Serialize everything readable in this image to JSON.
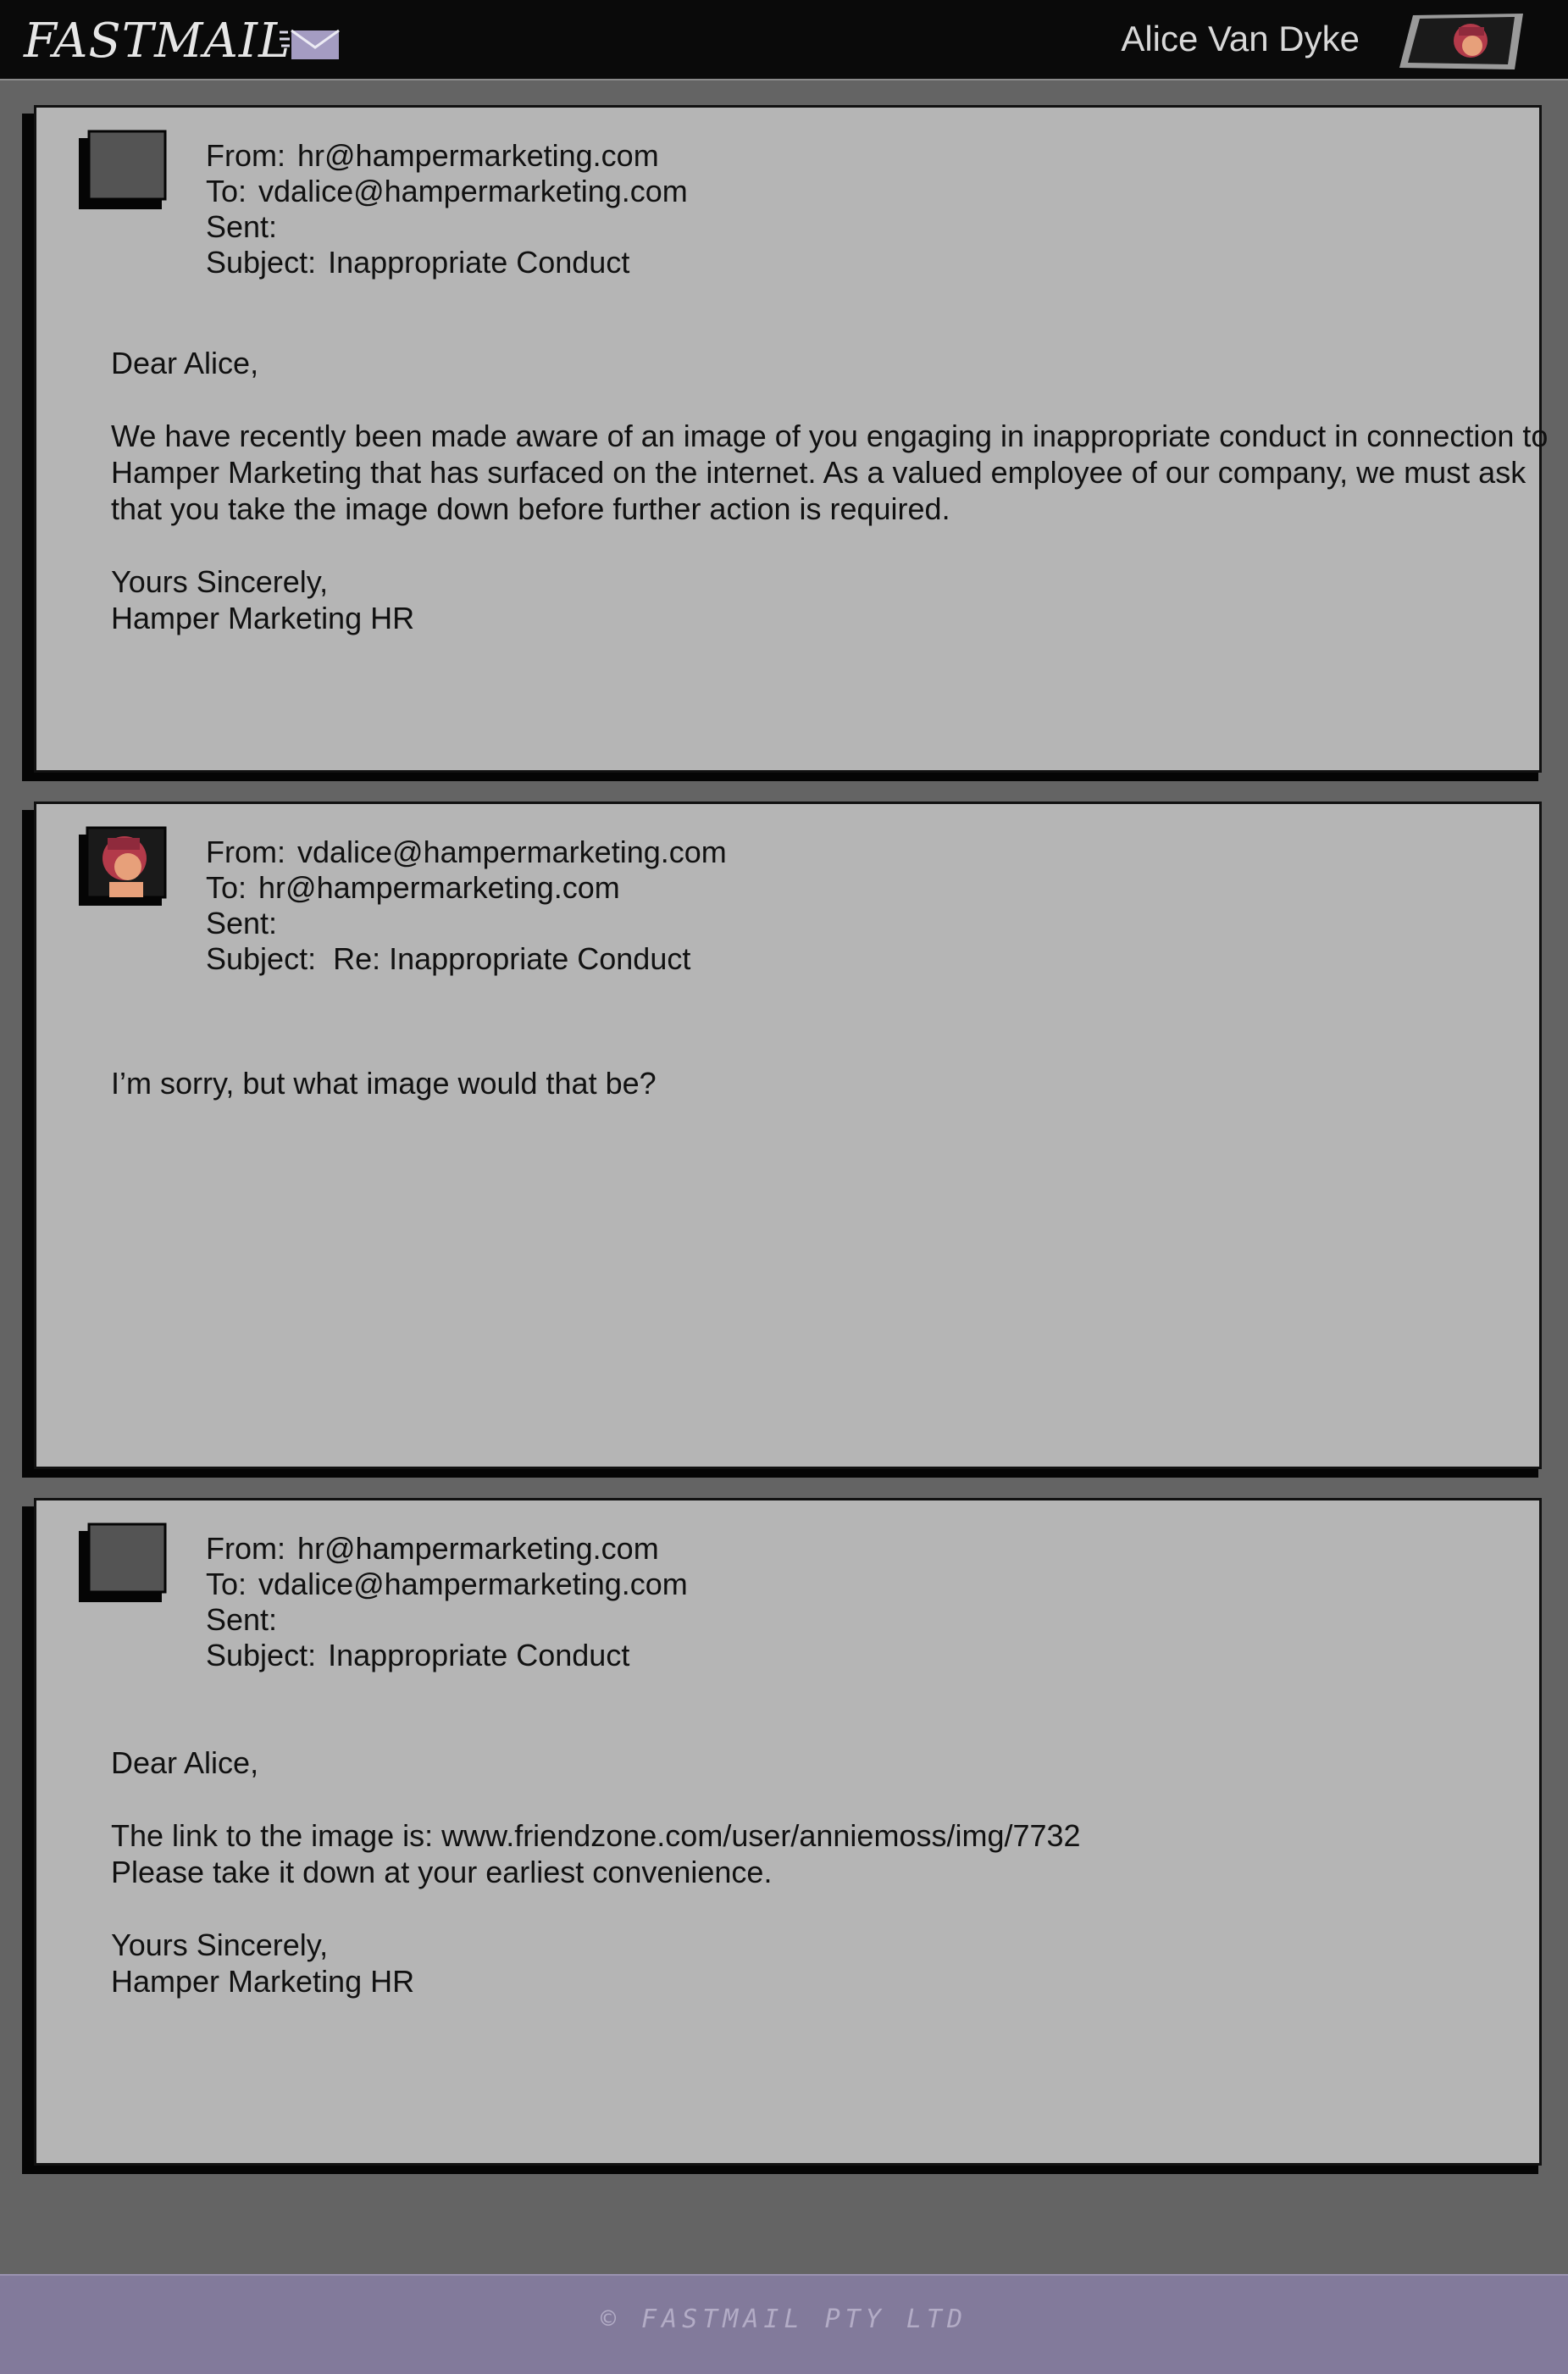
{
  "app": {
    "logo_text": "FASTMAIL",
    "user_name": "Alice Van Dyke",
    "footer_text": "© FASTMAIL PTY LTD"
  },
  "emails": [
    {
      "from_label": "From:",
      "from": "hr@hampermarketing.com",
      "to_label": "To:",
      "to": "vdalice@hampermarketing.com",
      "sent_label": "Sent:",
      "sent": "",
      "subject_label": "Subject:",
      "subject": "Inappropriate Conduct",
      "avatar": "blank-avatar",
      "greeting": "Dear Alice,",
      "paragraphs": [
        "We have recently been made aware of an image of you engaging in inappropriate conduct in connection to Hamper Marketing that has surfaced on the internet. As a valued employee of our company, we must ask that you take the image down before further action is required."
      ],
      "signoff_1": "Yours Sincerely,",
      "signoff_2": "Hamper Marketing HR"
    },
    {
      "from_label": "From:",
      "from": "vdalice@hampermarketing.com",
      "to_label": "To:",
      "to": "hr@hampermarketing.com",
      "sent_label": "Sent:",
      "sent": "",
      "subject_label": "Subject:",
      "subject": "Re: Inappropriate Conduct",
      "avatar": "alice-avatar",
      "greeting": "I’m sorry, but what image would that be?"
    },
    {
      "from_label": "From:",
      "from": "hr@hampermarketing.com",
      "to_label": "To:",
      "to": "vdalice@hampermarketing.com",
      "sent_label": "Sent:",
      "sent": "",
      "subject_label": "Subject:",
      "subject": "Inappropriate Conduct",
      "avatar": "blank-avatar",
      "greeting": "Dear Alice,",
      "line_1": "The link to the image is: www.friendzone.com/user/anniemoss/img/7732",
      "line_2": "Please take it down at your earliest convenience.",
      "signoff_1": "Yours Sincerely,",
      "signoff_2": "Hamper Marketing HR"
    }
  ],
  "colors": {
    "background": "#646464",
    "card": "#b5b5b5",
    "topbar": "#0a0a0a",
    "footer": "#827a9b"
  }
}
